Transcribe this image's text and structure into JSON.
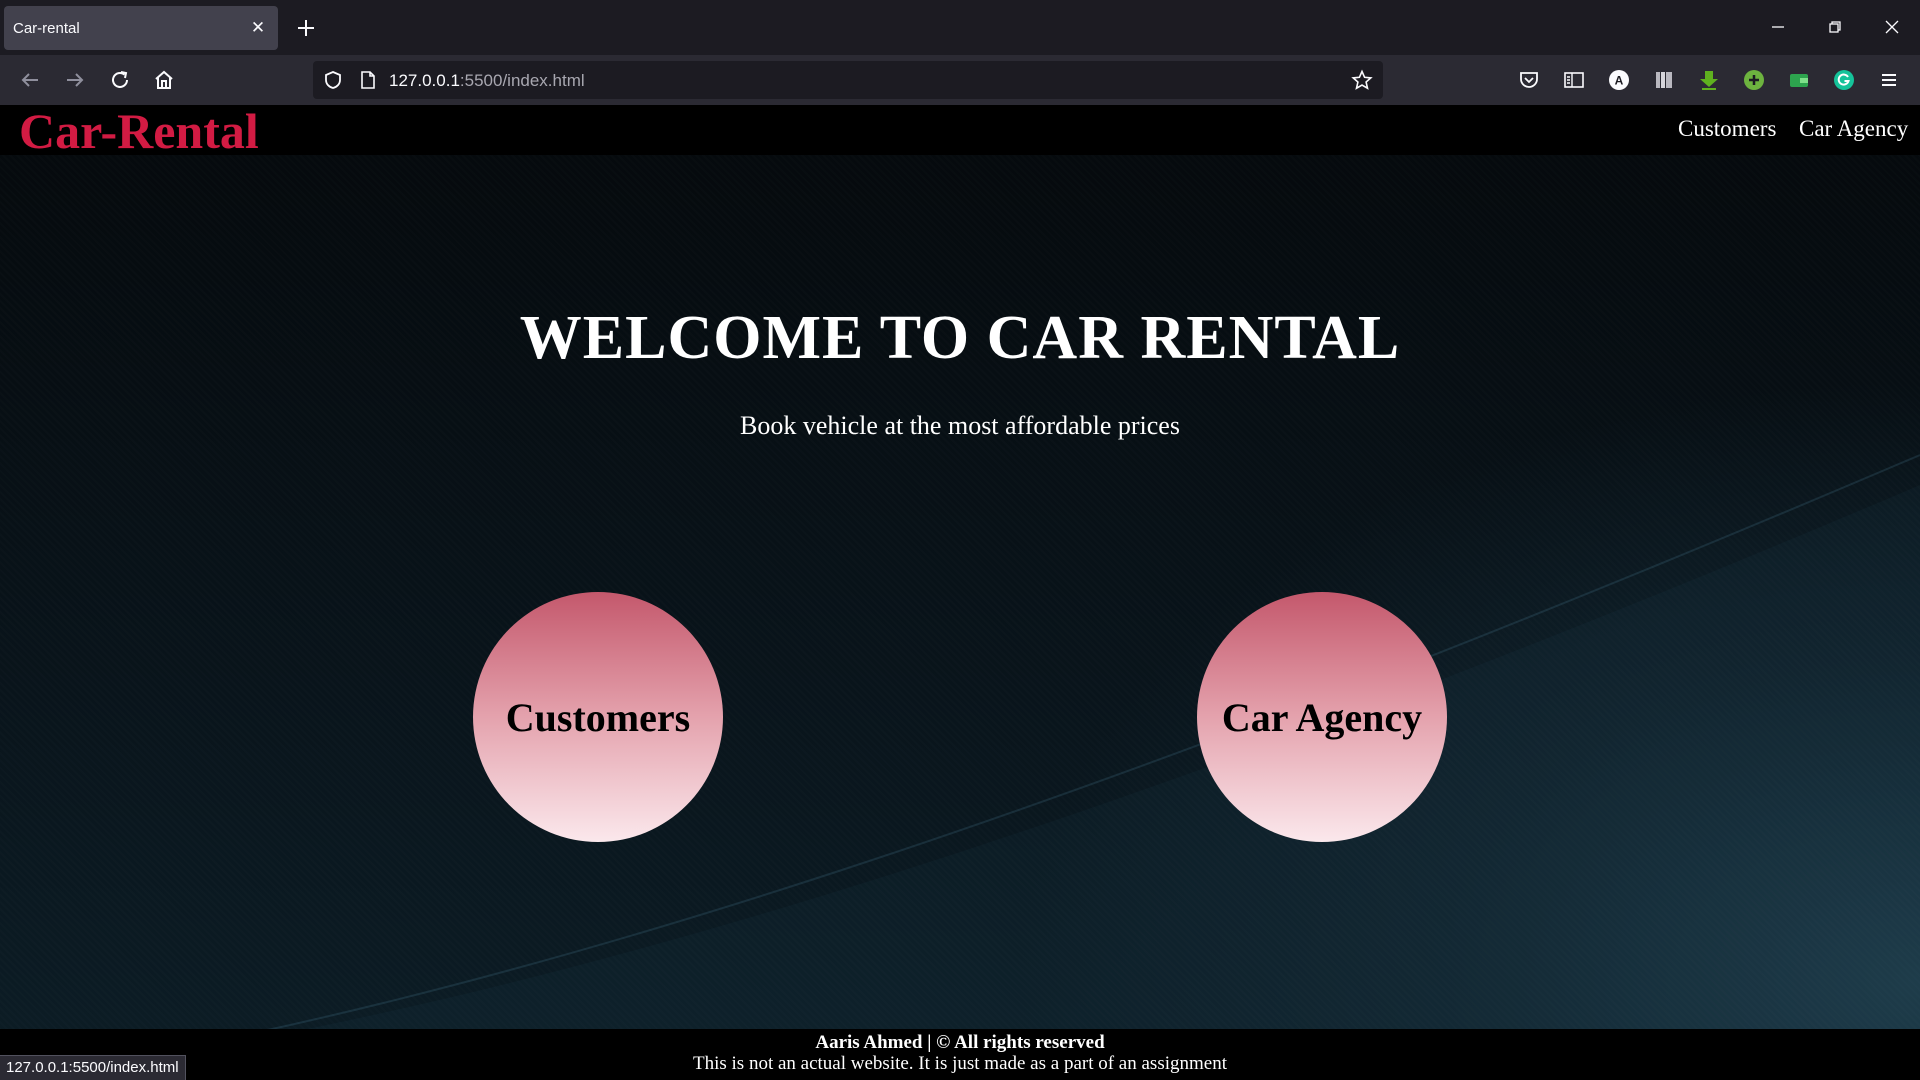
{
  "browser": {
    "tab_title": "Car-rental",
    "url_host": "127.0.0.1",
    "url_path": ":5500/index.html",
    "status_url": "127.0.0.1:5500/index.html"
  },
  "header": {
    "logo": "Car-Rental",
    "nav": [
      "Customers",
      "Car Agency"
    ]
  },
  "hero": {
    "title": "WELCOME TO CAR RENTAL",
    "subtitle": "Book vehicle at the most affordable prices"
  },
  "buttons": {
    "customers": "Customers",
    "agency": "Car Agency"
  },
  "footer": {
    "line1": "Aaris Ahmed | © All rights reserved",
    "line2": "This is not an actual website. It is just made as a part of an assignment"
  },
  "colors": {
    "logo": "#d21b43",
    "circle_top": "#c4586c",
    "circle_bottom": "#fbe8ec"
  }
}
